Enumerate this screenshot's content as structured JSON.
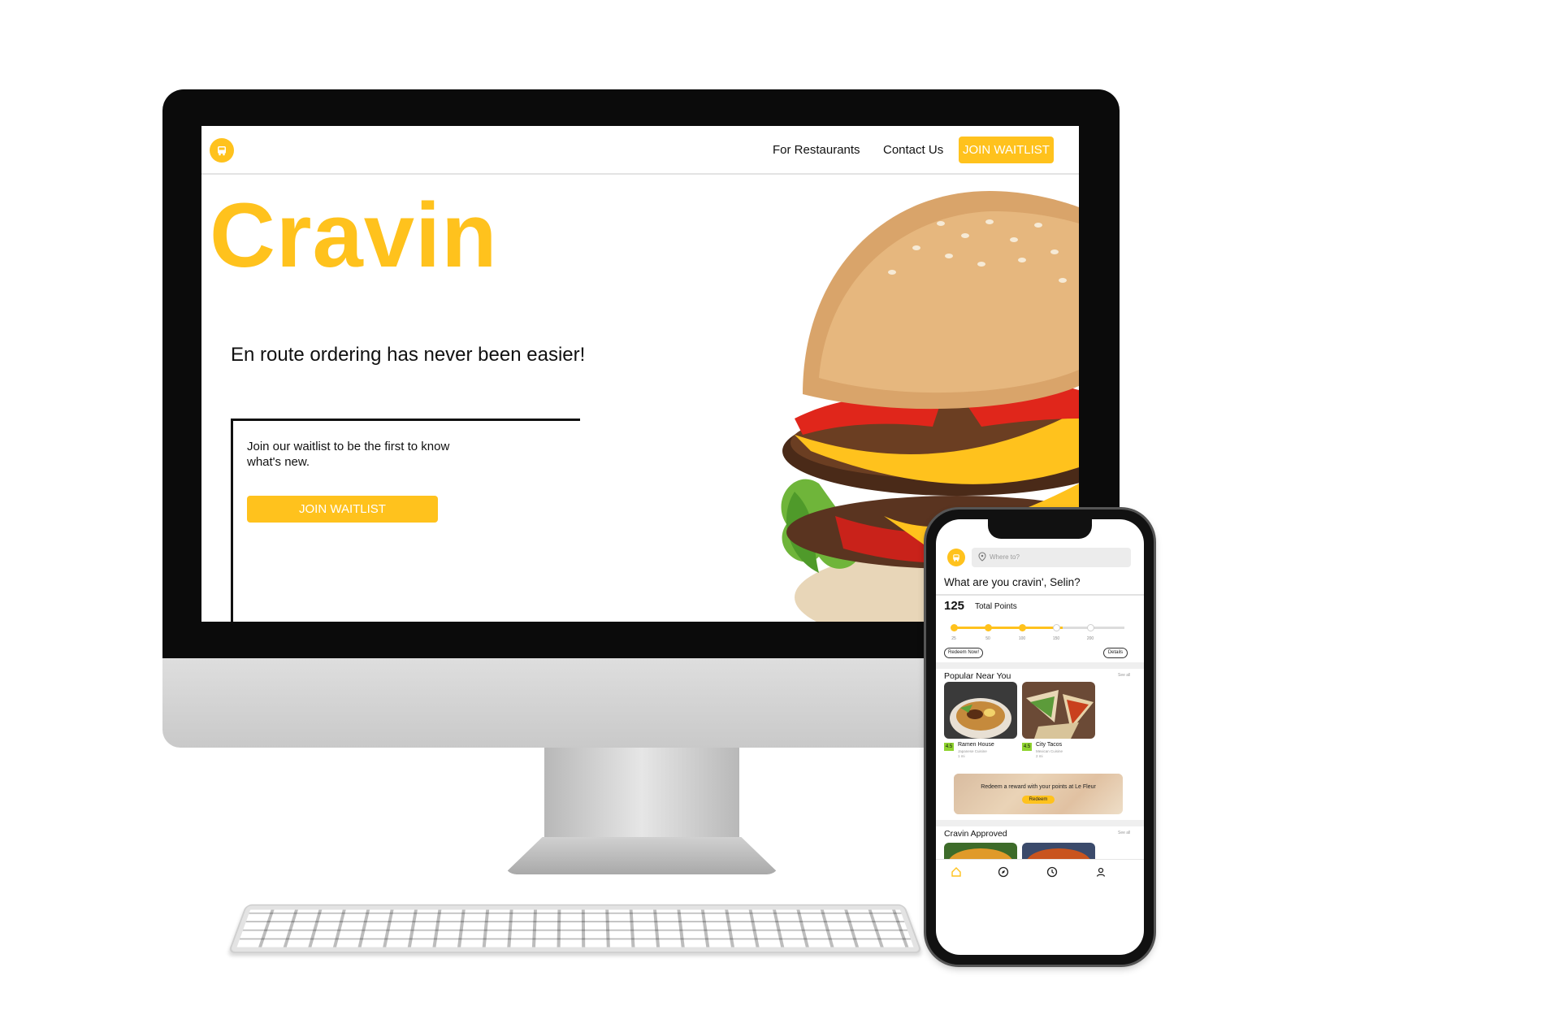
{
  "website": {
    "nav": {
      "links": [
        "For Restaurants",
        "Contact Us"
      ],
      "cta": "JOIN WAITLIST"
    },
    "hero": {
      "title": "Cravin",
      "subtitle": "En route ordering has never been easier!"
    },
    "waitlist": {
      "text": "Join our waitlist to be the first to know what's new.",
      "button": "JOIN WAITLIST"
    },
    "accent_color": "#ffc21d"
  },
  "app": {
    "search_placeholder": "Where to?",
    "greeting": "What are you cravin', Selin?",
    "points": {
      "value": "125",
      "label": "Total Points",
      "milestones": [
        "25",
        "50",
        "100",
        "150",
        "200"
      ],
      "redeem_button": "Redeem Now!",
      "details_button": "Details"
    },
    "popular": {
      "title": "Popular Near You",
      "see_all": "See all",
      "items": [
        {
          "name": "Ramen House",
          "cuisine": "Japanese Cuisine",
          "distance": "1 mi",
          "rating": "4.5"
        },
        {
          "name": "City Tacos",
          "cuisine": "Mexican Cuisine",
          "distance": "2 mi",
          "rating": "4.5"
        }
      ]
    },
    "promo": {
      "text": "Redeem a reward with your points at Le Fleur",
      "button": "Redeem"
    },
    "approved": {
      "title": "Cravin Approved",
      "see_all": "See all"
    },
    "tabs": [
      "home-icon",
      "compass-icon",
      "clock-icon",
      "profile-icon"
    ]
  }
}
